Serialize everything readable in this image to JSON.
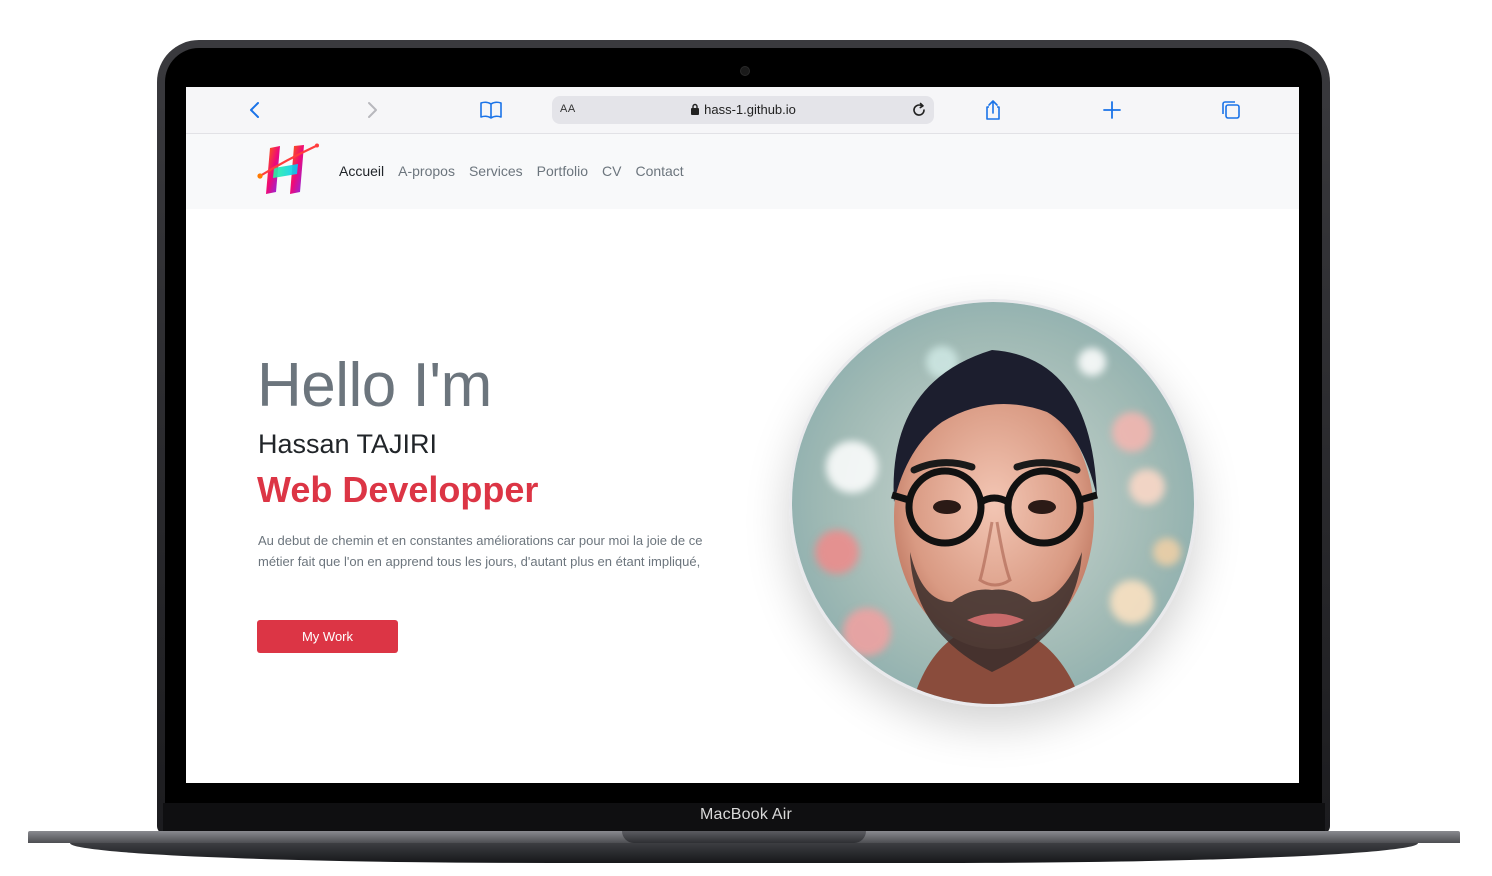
{
  "device": {
    "label": "MacBook Air"
  },
  "browser": {
    "text_size_label": "AA",
    "url": "hass-1.github.io"
  },
  "site": {
    "nav": [
      {
        "label": "Accueil",
        "active": true
      },
      {
        "label": "A-propos"
      },
      {
        "label": "Services"
      },
      {
        "label": "Portfolio"
      },
      {
        "label": "CV"
      },
      {
        "label": "Contact"
      }
    ],
    "hero": {
      "greeting": "Hello I'm",
      "name": "Hassan TAJIRI",
      "role": "Web Developper",
      "description": "Au debut de chemin et en constantes améliorations car pour moi la joie de ce métier fait que l'on en apprend tous les jours, d'autant plus en étant impliqué,",
      "button_label": "My Work"
    }
  },
  "colors": {
    "accent": "#dc3545",
    "browser_blue": "#1a73e8"
  }
}
